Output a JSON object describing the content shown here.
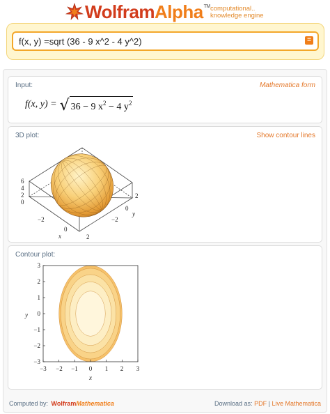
{
  "header": {
    "logo": {
      "word1": "Wolfram",
      "word2": "Alpha",
      "tm": "TM"
    },
    "tagline_line1": "computational..",
    "tagline_line2": "knowledge engine"
  },
  "search": {
    "value": "f(x, y) =sqrt (36 - 9 x^2 - 4 y^2)",
    "button_icon": "equals-icon"
  },
  "pods": {
    "input": {
      "title": "Input:",
      "link": "Mathematica form",
      "formula_lhs": "f(x, y) =",
      "formula_rhs": "36 − 9 x",
      "formula_mid": " − 4 y",
      "exp": "2"
    },
    "plot3d": {
      "title": "3D plot:",
      "link": "Show contour lines",
      "z_ticks": [
        "6",
        "4",
        "2",
        "0"
      ],
      "x_ticks": [
        "−2",
        "0",
        "2"
      ],
      "x_label": "x",
      "y_ticks": [
        "2",
        "0",
        "−2"
      ],
      "y_label": "y"
    },
    "contour": {
      "title": "Contour plot:",
      "y_ticks": [
        "3",
        "2",
        "1",
        "0",
        "−1",
        "−2",
        "−3"
      ],
      "x_ticks": [
        "−3",
        "−2",
        "−1",
        "0",
        "1",
        "2",
        "3"
      ],
      "x_label": "x",
      "y_label": "y",
      "fill_colors": [
        "#f6c16a",
        "#f9d388",
        "#fbe2a6",
        "#fdeec4",
        "#fff6dc"
      ]
    }
  },
  "footer": {
    "computed_by": "Computed by:",
    "wolfram": "Wolfram",
    "mathematica": "Mathematica",
    "download_as": "Download as:",
    "pdf": "PDF",
    "separator": "|",
    "live": "Live Mathematica"
  }
}
